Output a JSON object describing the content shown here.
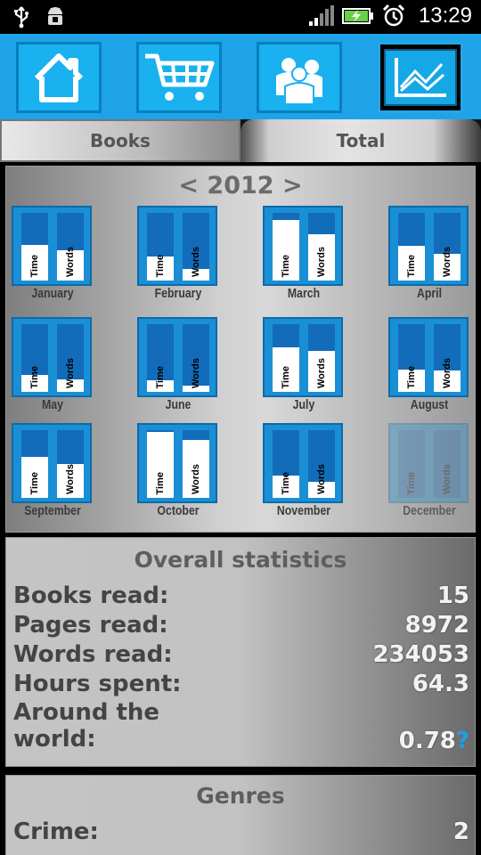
{
  "status_bar": {
    "time": "13:29"
  },
  "nav": [
    {
      "icon": "home-icon"
    },
    {
      "icon": "cart-icon"
    },
    {
      "icon": "people-icon"
    },
    {
      "icon": "chart-icon",
      "active": true
    }
  ],
  "tabs": {
    "books": "Books",
    "total": "Total"
  },
  "calendar": {
    "prev": "<",
    "year": "2012",
    "next": ">",
    "time_label": "Time",
    "words_label": "Words",
    "months": [
      {
        "name": "January",
        "time": 0.53,
        "words": 0.45
      },
      {
        "name": "February",
        "time": 0.35,
        "words": 0.17
      },
      {
        "name": "March",
        "time": 0.9,
        "words": 0.69
      },
      {
        "name": "April",
        "time": 0.51,
        "words": 0.4
      },
      {
        "name": "May",
        "time": 0.25,
        "words": 0.19
      },
      {
        "name": "June",
        "time": 0.17,
        "words": 0.09
      },
      {
        "name": "July",
        "time": 0.66,
        "words": 0.6
      },
      {
        "name": "August",
        "time": 0.33,
        "words": 0.31
      },
      {
        "name": "September",
        "time": 0.6,
        "words": 0.5
      },
      {
        "name": "October",
        "time": 0.98,
        "words": 0.85
      },
      {
        "name": "November",
        "time": 0.33,
        "words": 0.24
      },
      {
        "name": "December",
        "time": 0.0,
        "words": 0.0,
        "dim": true
      }
    ]
  },
  "overall": {
    "title": "Overall statistics",
    "rows": [
      {
        "label": "Books read:",
        "value": "15"
      },
      {
        "label": "Pages read:",
        "value": "8972"
      },
      {
        "label": "Words read:",
        "value": "234053"
      },
      {
        "label": "Hours spent:",
        "value": "64.3"
      }
    ],
    "around_label_1": "Around the",
    "around_label_2": "world:",
    "around_value": "0.78",
    "help": "?"
  },
  "genres": {
    "title": "Genres",
    "rows": [
      {
        "label": "Crime:",
        "value": "2"
      }
    ]
  }
}
